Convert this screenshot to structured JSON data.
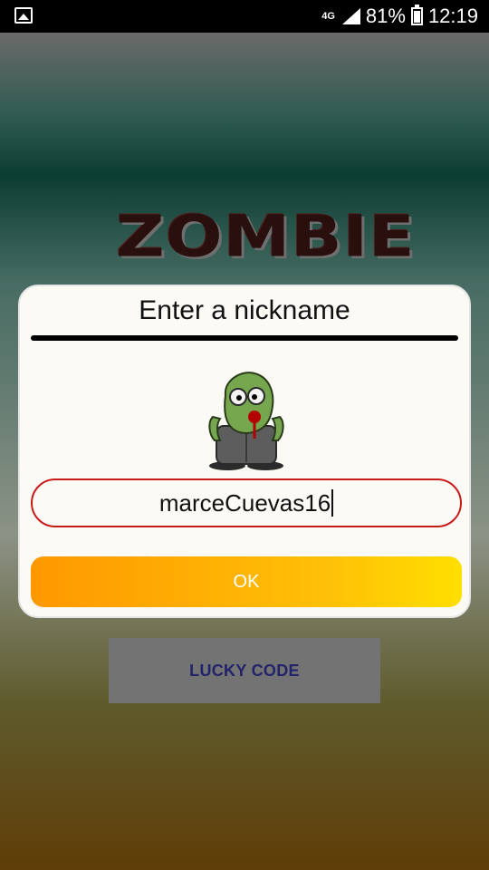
{
  "status_bar": {
    "network": "4G",
    "battery": "81%",
    "time": "12:19",
    "icons": [
      "gallery-icon",
      "signal-icon",
      "battery-icon"
    ]
  },
  "app": {
    "logo_text": "ZOMBIE",
    "lucky_button_label": "LUCKY CODE"
  },
  "dialog": {
    "title": "Enter a nickname",
    "mascot": "zombie-mascot-icon",
    "nickname_value": "marceCuevas16",
    "ok_label": "OK"
  },
  "colors": {
    "input_border": "#c91a1a",
    "ok_gradient_start": "#ff9800",
    "ok_gradient_end": "#ffdf00",
    "lucky_button_bg": "#737373",
    "lucky_button_text": "#23236a"
  }
}
